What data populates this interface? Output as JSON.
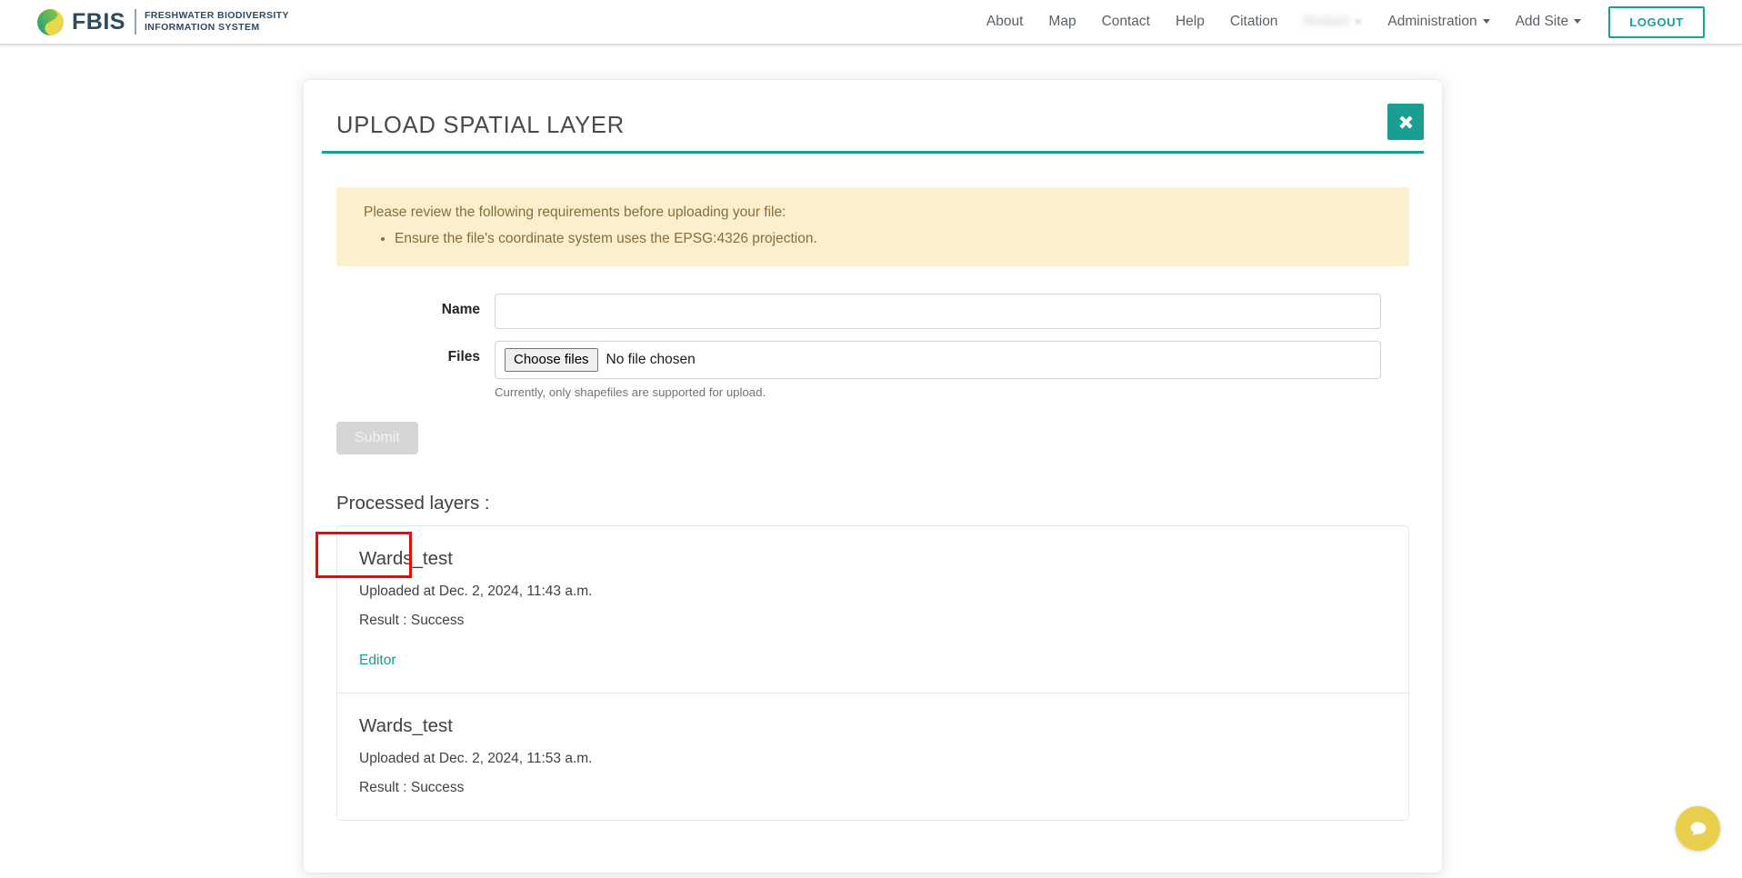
{
  "brand": {
    "name": "FBIS",
    "subtitle_line1": "FRESHWATER BIODIVERSITY",
    "subtitle_line2": "INFORMATION SYSTEM",
    "logo_icon": "fbis-logo-icon"
  },
  "nav": {
    "links": [
      {
        "label": "About",
        "name": "nav-link-about"
      },
      {
        "label": "Map",
        "name": "nav-link-map"
      },
      {
        "label": "Contact",
        "name": "nav-link-contact"
      },
      {
        "label": "Help",
        "name": "nav-link-help"
      },
      {
        "label": "Citation",
        "name": "nav-link-citation"
      }
    ],
    "user_menu_label": "",
    "dropdowns": [
      {
        "label": "Administration",
        "name": "nav-dropdown-administration"
      },
      {
        "label": "Add Site",
        "name": "nav-dropdown-add-site"
      }
    ],
    "logout_label": "LOGOUT"
  },
  "modal": {
    "title": "UPLOAD SPATIAL LAYER",
    "close_icon": "close-icon",
    "accent_color": "#1a9e92"
  },
  "alert": {
    "background_color": "#fcefcd",
    "text_color": "#8a6d3b",
    "title": "Please review the following requirements before uploading your file:",
    "items": [
      "Ensure the file's coordinate system uses the EPSG:4326 projection."
    ]
  },
  "form": {
    "name_label": "Name",
    "name_value": "",
    "name_placeholder": "",
    "files_label": "Files",
    "choose_files_label": "Choose files",
    "no_file_chosen_label": "No file chosen",
    "help_text": "Currently, only shapefiles are supported for upload.",
    "submit_label": "Submit",
    "submit_disabled": true
  },
  "processed": {
    "heading": "Processed layers :",
    "layers": [
      {
        "name": "Wards_test",
        "uploaded": "Uploaded at Dec. 2, 2024, 11:43 a.m.",
        "result": "Result : Success",
        "editor_label": "Editor",
        "has_editor": true,
        "highlighted": true
      },
      {
        "name": "Wards_test",
        "uploaded": "Uploaded at Dec. 2, 2024, 11:53 a.m.",
        "result": "Result : Success",
        "editor_label": "",
        "has_editor": false,
        "highlighted": false
      }
    ]
  },
  "annotation": {
    "color": "#fe0000",
    "target": "editor-link"
  },
  "chat": {
    "icon": "chat-bubble-icon",
    "color": "#e8cf4d"
  }
}
